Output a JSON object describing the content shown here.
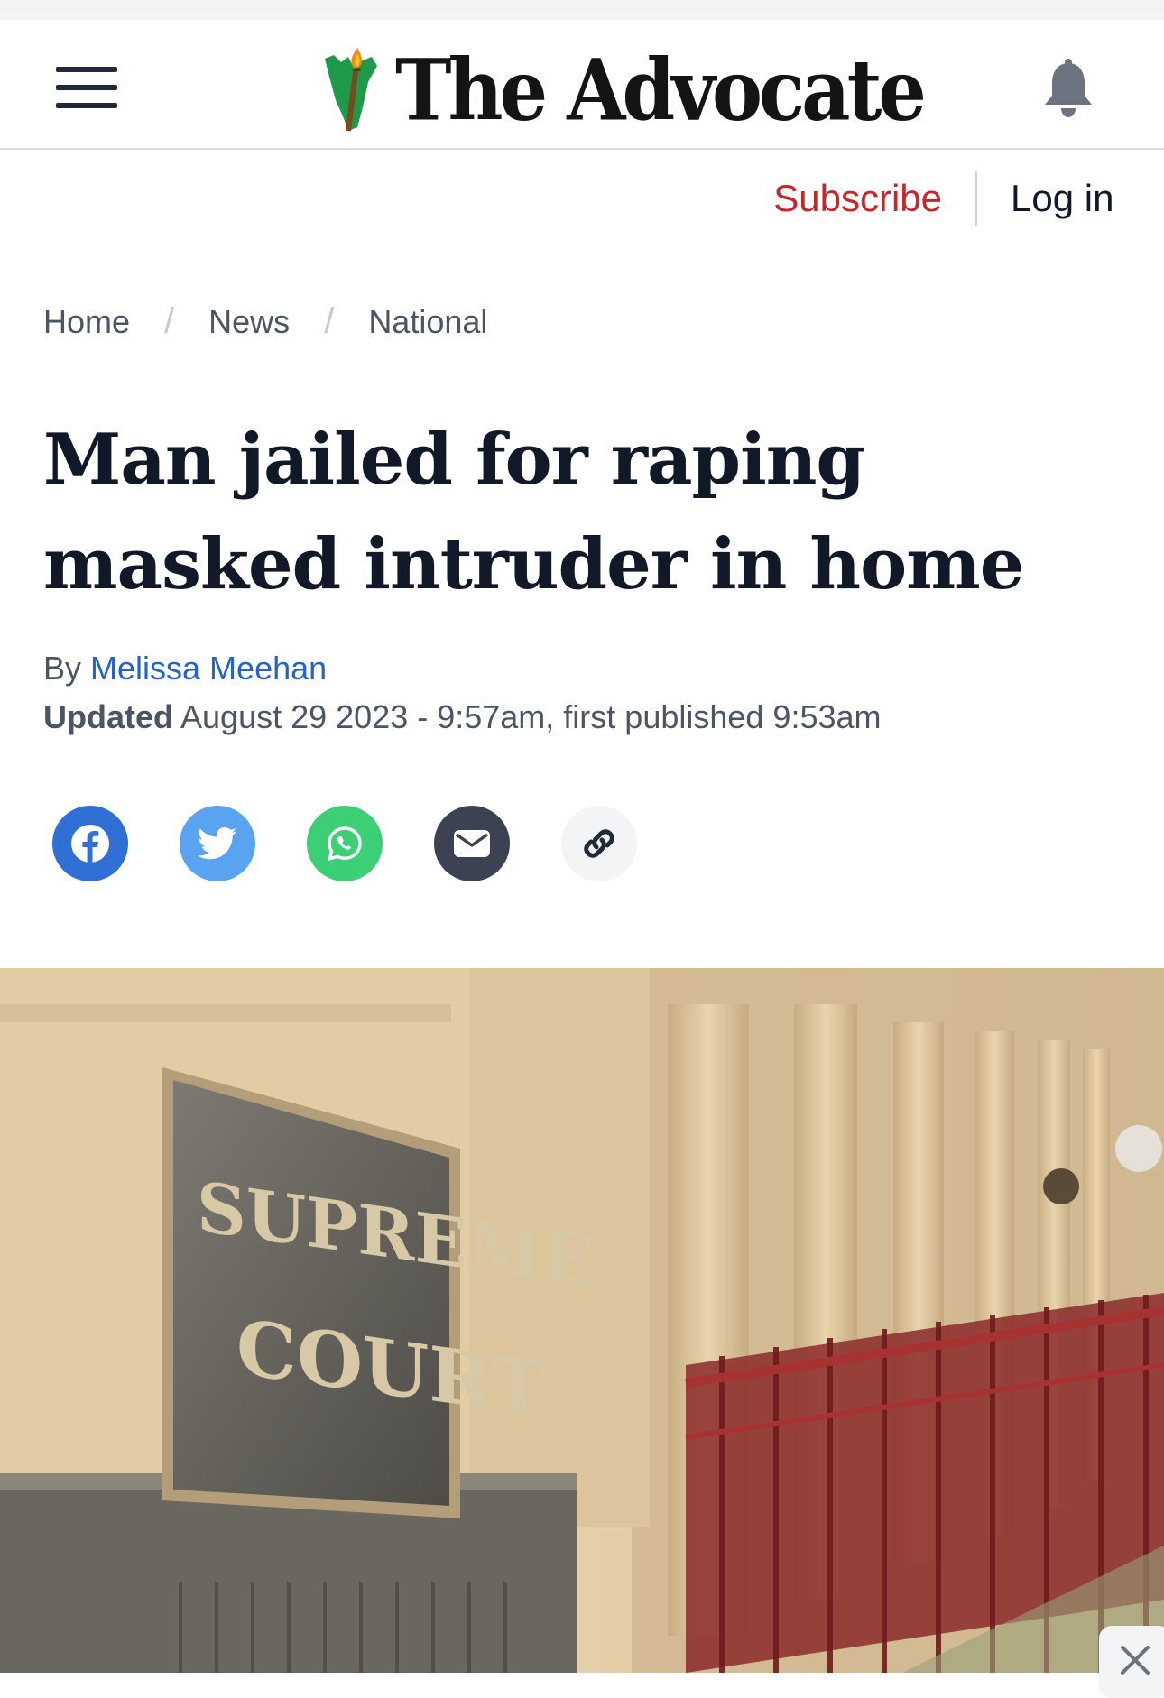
{
  "header": {
    "menu_icon": "hamburger-menu-icon",
    "logo_text": "The Advocate",
    "notification_icon": "bell-icon"
  },
  "account": {
    "subscribe_label": "Subscribe",
    "login_label": "Log in"
  },
  "breadcrumb": {
    "items": [
      "Home",
      "News",
      "National"
    ],
    "separator": "/"
  },
  "article": {
    "headline": "Man jailed for raping masked intruder in home",
    "byline_prefix": "By",
    "author": "Melissa Meehan",
    "updated_label": "Updated",
    "updated_text": "August 29 2023 - 9:57am, first published 9:53am"
  },
  "share": {
    "buttons": [
      "facebook-icon",
      "twitter-icon",
      "whatsapp-icon",
      "email-icon",
      "link-icon"
    ]
  },
  "hero": {
    "sign_line1": "SUPREME",
    "sign_line2": "COURT"
  },
  "overlay": {
    "close_icon": "close-icon"
  },
  "colors": {
    "brand_red": "#c8252c",
    "link_blue": "#2563c9",
    "text_dark": "#111827",
    "facebook": "#2f6fd6",
    "twitter": "#5aa3f0",
    "whatsapp": "#3ccf75",
    "email": "#3c4251"
  }
}
